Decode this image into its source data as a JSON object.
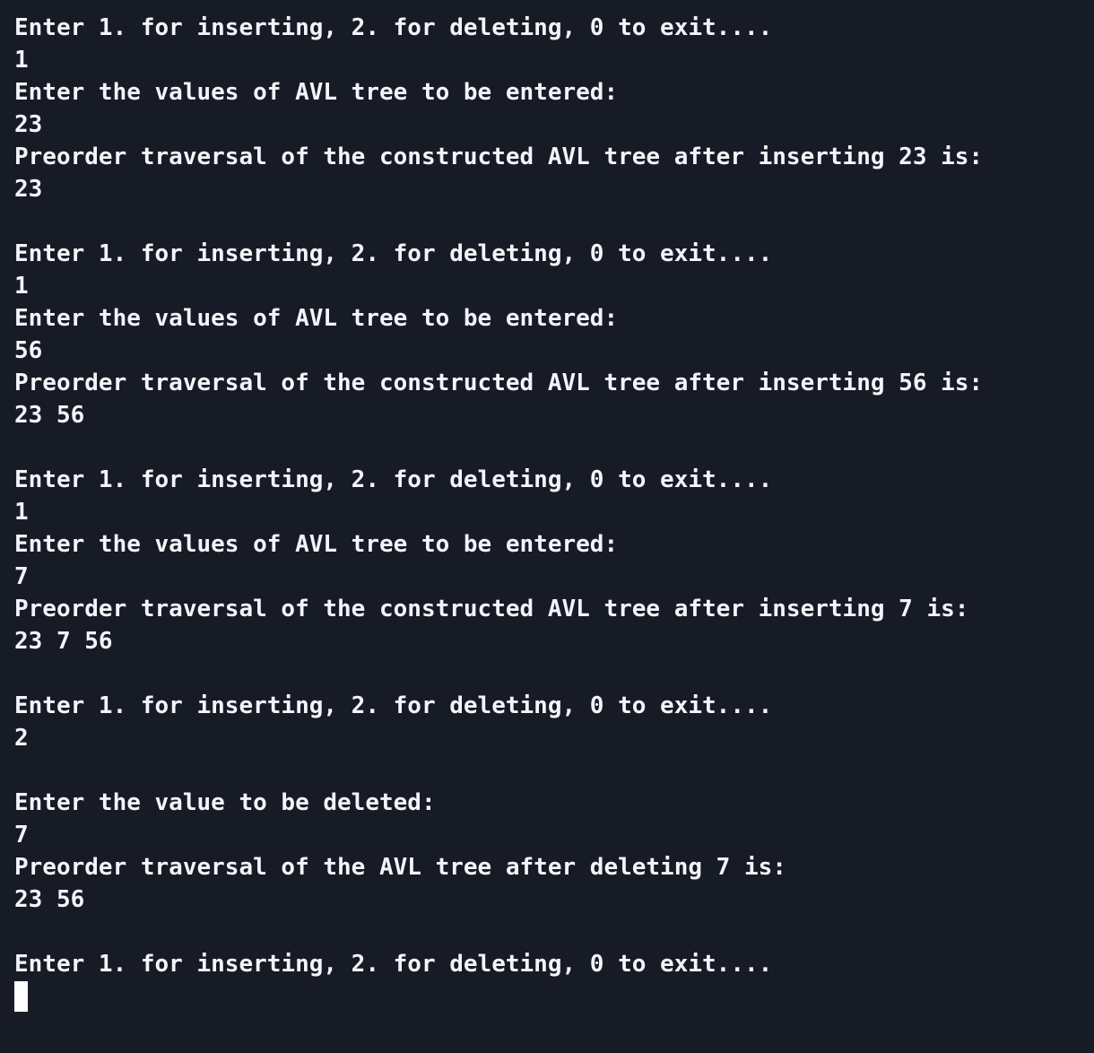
{
  "terminal": {
    "lines": [
      "Enter 1. for inserting, 2. for deleting, 0 to exit....",
      "1",
      "Enter the values of AVL tree to be entered:",
      "23",
      "Preorder traversal of the constructed AVL tree after inserting 23 is:",
      "23",
      "",
      "Enter 1. for inserting, 2. for deleting, 0 to exit....",
      "1",
      "Enter the values of AVL tree to be entered:",
      "56",
      "Preorder traversal of the constructed AVL tree after inserting 56 is:",
      "23 56",
      "",
      "Enter 1. for inserting, 2. for deleting, 0 to exit....",
      "1",
      "Enter the values of AVL tree to be entered:",
      "7",
      "Preorder traversal of the constructed AVL tree after inserting 7 is:",
      "23 7 56",
      "",
      "Enter 1. for inserting, 2. for deleting, 0 to exit....",
      "2",
      "",
      "Enter the value to be deleted:",
      "7",
      "Preorder traversal of the AVL tree after deleting 7 is:",
      "23 56",
      "",
      "Enter 1. for inserting, 2. for deleting, 0 to exit...."
    ]
  },
  "colors": {
    "background": "#171b26",
    "text": "#f3f4f8",
    "cursor": "#ffffff"
  }
}
